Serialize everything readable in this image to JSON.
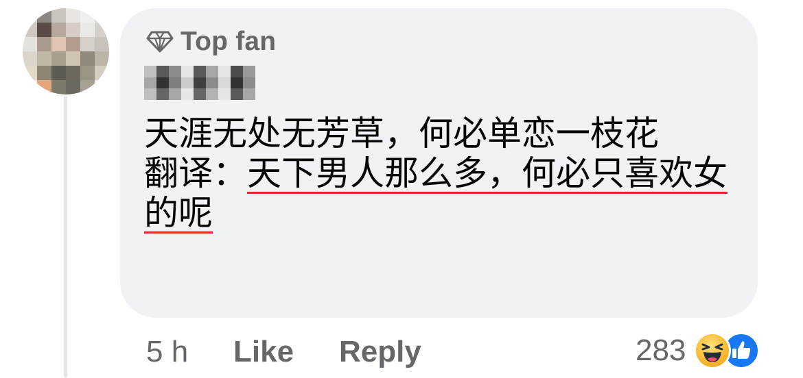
{
  "avatar_colors": [
    "#d9d6d2",
    "#8b8682",
    "#c9c4be",
    "#e8e6e3",
    "#f0efed",
    "#dddad6",
    "#cfc9c2",
    "#5a4c44",
    "#b7a89d",
    "#d8cdc6",
    "#ece9e6",
    "#d3cfcb",
    "#e5e1dc",
    "#a99a8d",
    "#e0c4b6",
    "#b29c8f",
    "#d6d0ca",
    "#c8c2ba",
    "#dcd5cc",
    "#c0b8a9",
    "#a89f8e",
    "#cfc4b4",
    "#8f8a7c",
    "#bcb4a6",
    "#e4d8c8",
    "#8e8576",
    "#5e5b50",
    "#6d6a5d",
    "#9a9484",
    "#d4ccbe",
    "#f0ebe4",
    "#e4a57a",
    "#7d7a6c",
    "#6a695e",
    "#a7a293",
    "#f1ede7"
  ],
  "name_colors": [
    "#bfbfbf",
    "#595959",
    "#8c8c8c",
    "#e6e6e6",
    "#595959",
    "#a6a6a6",
    "#e6e6e6",
    "#4d4d4d",
    "#999999",
    "#a6a6a6",
    "#333333",
    "#7f7f7f",
    "#cccccc",
    "#404040",
    "#8c8c8c",
    "#d9d9d9",
    "#333333",
    "#8c8c8c",
    "#bfbfbf",
    "#666666",
    "#a6a6a6",
    "#e6e6e6",
    "#666666",
    "#b3b3b3",
    "#e6e6e6",
    "#595959",
    "#a6a6a6"
  ],
  "badge": {
    "icon": "diamond-icon",
    "label": "Top fan"
  },
  "comment": {
    "line1": "天涯无处无芳草，何必单恋一枝花",
    "translation_label": "翻译：",
    "translation_text": "天下男人那么多，何必只喜欢女的呢",
    "underline_color": "#e0242c"
  },
  "actions": {
    "time": "5 h",
    "like": "Like",
    "reply": "Reply"
  },
  "reactions": {
    "count": "283",
    "icons": [
      "haha-icon",
      "like-icon"
    ]
  },
  "colors": {
    "bubble": "#f0f2f5",
    "secondary_text": "#65676b",
    "like_blue": "#1877f2"
  }
}
